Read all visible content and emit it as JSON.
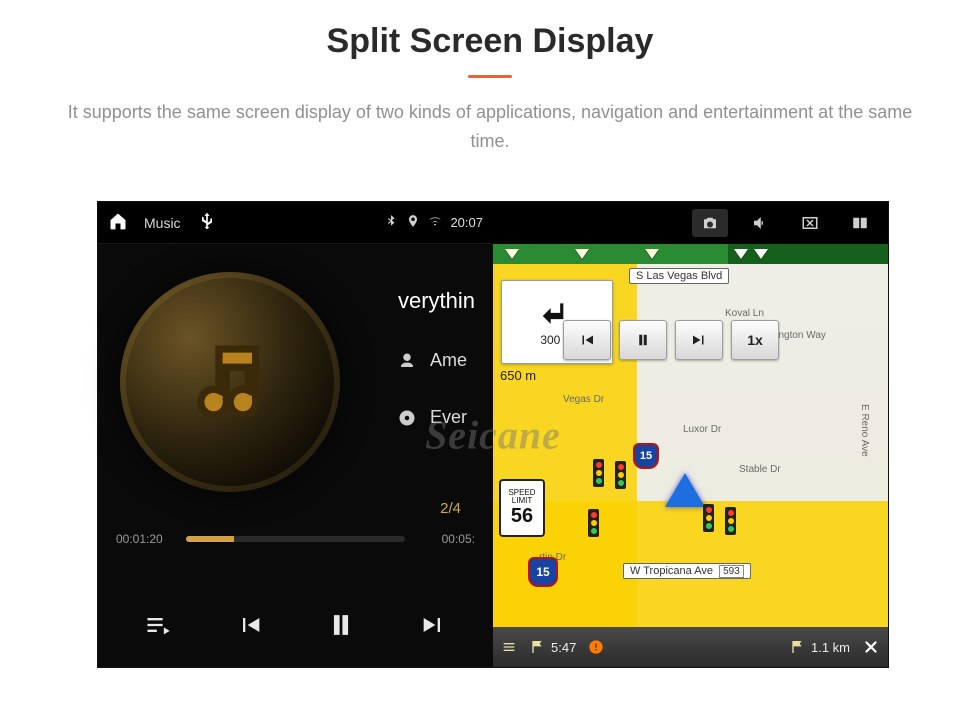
{
  "page": {
    "title": "Split Screen Display",
    "description": "It supports the same screen display of two kinds of applications, navigation and entertainment at the same time."
  },
  "music": {
    "topbar": {
      "app_label": "Music",
      "time": "20:07"
    },
    "track": {
      "title_partial": "verythin",
      "artist_partial": "Ame",
      "album_partial": "Ever"
    },
    "counter": "2/4",
    "elapsed": "00:01:20",
    "duration": "00:05:"
  },
  "nav": {
    "turn": {
      "dist1": "300 m",
      "dist2": "650 m"
    },
    "sim_speed": "1x",
    "speed_limit": {
      "tag1": "SPEED",
      "tag2": "LIMIT",
      "value": "56"
    },
    "interstate": "15",
    "interstate2": "15",
    "roads": {
      "top_main": "S Las Vegas Blvd",
      "koval": "Koval Ln",
      "duke": "Duke Ellington Way",
      "vegas_dr": "Vegas Dr",
      "luxor": "Luxor Dr",
      "reno": "E Reno Ave",
      "stable": "Stable Dr",
      "martin": "rtin Dr",
      "tropicana": "W Tropicana Ave",
      "tropicana_box": "593"
    },
    "bottom": {
      "eta": "5:47",
      "dist": "1.1 km"
    }
  },
  "watermark": "Seicane"
}
